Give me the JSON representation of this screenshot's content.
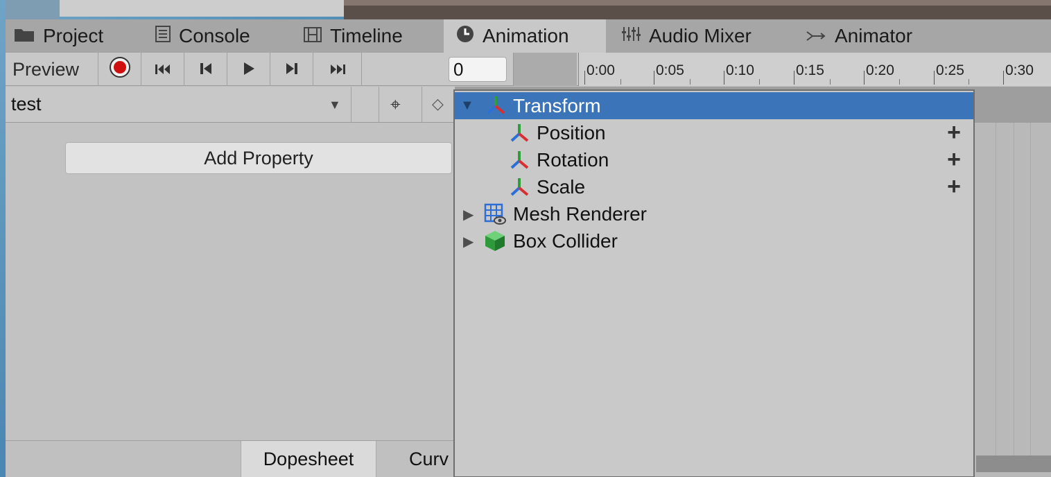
{
  "tabs": [
    {
      "label": "Project",
      "icon": "folder-icon",
      "active": false
    },
    {
      "label": "Console",
      "icon": "console-icon",
      "active": false
    },
    {
      "label": "Timeline",
      "icon": "film-icon",
      "active": false
    },
    {
      "label": "Animation",
      "icon": "clock-icon",
      "active": true
    },
    {
      "label": "Audio Mixer",
      "icon": "mixer-icon",
      "active": false
    },
    {
      "label": "Animator",
      "icon": "animator-icon",
      "active": false
    }
  ],
  "toolbar": {
    "preview_label": "Preview",
    "record_icon": "record-icon",
    "first_key_icon": "skip-first-icon",
    "prev_key_icon": "step-back-icon",
    "play_icon": "play-icon",
    "next_key_icon": "step-forward-icon",
    "last_key_icon": "skip-last-icon",
    "frame_value": "0",
    "record_color": "#d01010"
  },
  "ruler": {
    "labels": [
      "0:00",
      "0:05",
      "0:10",
      "0:15",
      "0:20",
      "0:25",
      "0:30"
    ]
  },
  "clip": {
    "name": "test"
  },
  "panel": {
    "add_property_label": "Add Property"
  },
  "bottom_tabs": {
    "dopesheet": "Dopesheet",
    "curves": "Curv"
  },
  "popup": {
    "items": [
      {
        "label": "Transform",
        "icon": "transform-icon",
        "expanded": true,
        "selected": true,
        "level": 0
      },
      {
        "label": "Position",
        "icon": "transform-icon",
        "level": 1,
        "addable": true
      },
      {
        "label": "Rotation",
        "icon": "transform-icon",
        "level": 1,
        "addable": true
      },
      {
        "label": "Scale",
        "icon": "transform-icon",
        "level": 1,
        "addable": true
      },
      {
        "label": "Mesh Renderer",
        "icon": "mesh-renderer-icon",
        "expanded": false,
        "level": 0
      },
      {
        "label": "Box Collider",
        "icon": "box-collider-icon",
        "expanded": false,
        "level": 0
      }
    ],
    "plus_symbol": "+",
    "selection_color": "#3b74b8"
  }
}
